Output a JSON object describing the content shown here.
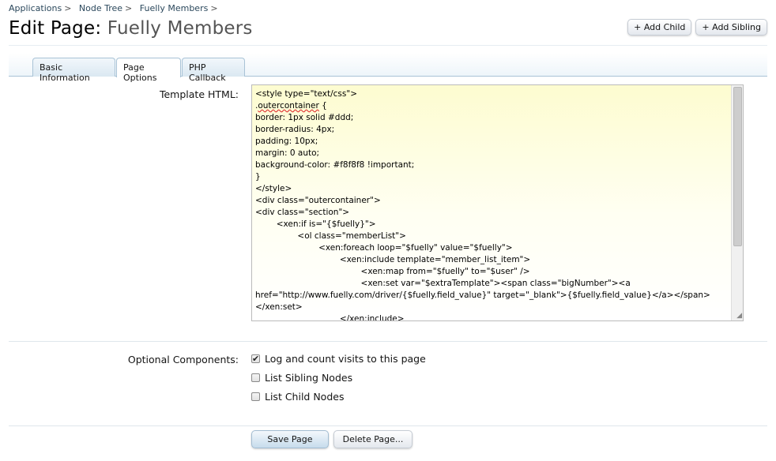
{
  "breadcrumb": {
    "items": [
      "Applications",
      "Node Tree",
      "Fuelly Members"
    ],
    "separator": ">"
  },
  "header": {
    "title_prefix": "Edit Page:",
    "title_name": "Fuelly Members",
    "add_child": "+ Add Child",
    "add_sibling": "+ Add Sibling"
  },
  "tabs": [
    {
      "label": "Basic Information",
      "active": false
    },
    {
      "label": "Page Options",
      "active": true
    },
    {
      "label": "PHP Callback",
      "active": false
    }
  ],
  "template": {
    "label": "Template HTML:",
    "lines": [
      "<style type=\"text/css\">",
      ".outercontainer {",
      "border: 1px solid #ddd;",
      "border-radius: 4px;",
      "padding: 10px;",
      "margin: 0 auto;",
      "background-color: #f8f8f8 !important;",
      "}",
      "</style>",
      "<div class=\"outercontainer\">",
      "<div class=\"section\">",
      "        <xen:if is=\"{$fuelly}\">",
      "                <ol class=\"memberList\">",
      "                        <xen:foreach loop=\"$fuelly\" value=\"$fuelly\">",
      "                                <xen:include template=\"member_list_item\">",
      "                                        <xen:map from=\"$fuelly\" to=\"$user\" />",
      "                                        <xen:set var=\"$extraTemplate\"><span class=\"bigNumber\"><a",
      "href=\"http://www.fuelly.com/driver/{$fuelly.field_value}\" target=\"_blank\">{$fuelly.field_value}</a></span>",
      "</xen:set>",
      "                                </xen:include>"
    ]
  },
  "optional_components": {
    "label": "Optional Components:",
    "options": [
      {
        "label": "Log and count visits to this page",
        "checked": true
      },
      {
        "label": "List Sibling Nodes",
        "checked": false
      },
      {
        "label": "List Child Nodes",
        "checked": false
      }
    ]
  },
  "actions": {
    "save": "Save Page",
    "delete": "Delete Page..."
  },
  "colors": {
    "link": "#2b485c",
    "tab_border": "#a9c3d6",
    "editor_bg_top": "#fdfcd0"
  }
}
